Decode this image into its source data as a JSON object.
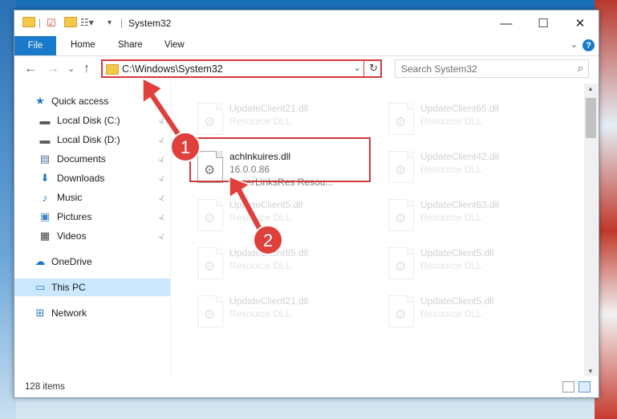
{
  "window": {
    "title": "System32",
    "minimize_glyph": "—",
    "maximize_glyph": "☐",
    "close_glyph": "✕"
  },
  "ribbon": {
    "tabs": [
      "File",
      "Home",
      "Share",
      "View"
    ],
    "help_glyph": "?",
    "collapse_glyph": "⌄"
  },
  "nav": {
    "back": "←",
    "forward": "→",
    "recent": "⌄",
    "up": "↑",
    "address": "C:\\Windows\\System32",
    "address_dropdown": "⌄",
    "refresh": "↻",
    "search_placeholder": "Search System32",
    "search_icon_glyph": "⌕"
  },
  "sidebar": {
    "items": [
      {
        "label": "Quick access",
        "icon": "star-icon",
        "glyph": "★",
        "color": "#1979ca",
        "indent": false,
        "pinned": false
      },
      {
        "label": "Local Disk (C:)",
        "icon": "drive-icon",
        "glyph": "▬",
        "color": "#5a5a5a",
        "indent": true,
        "pinned": true
      },
      {
        "label": "Local Disk (D:)",
        "icon": "drive-icon",
        "glyph": "▬",
        "color": "#5a5a5a",
        "indent": true,
        "pinned": true
      },
      {
        "label": "Documents",
        "icon": "documents-icon",
        "glyph": "▤",
        "color": "#4a6f9c",
        "indent": true,
        "pinned": true
      },
      {
        "label": "Downloads",
        "icon": "download-icon",
        "glyph": "⬇",
        "color": "#1979ca",
        "indent": true,
        "pinned": true
      },
      {
        "label": "Music",
        "icon": "music-icon",
        "glyph": "♪",
        "color": "#1979ca",
        "indent": true,
        "pinned": true
      },
      {
        "label": "Pictures",
        "icon": "pictures-icon",
        "glyph": "▣",
        "color": "#3d86c9",
        "indent": true,
        "pinned": true
      },
      {
        "label": "Videos",
        "icon": "videos-icon",
        "glyph": "▦",
        "color": "#444444",
        "indent": true,
        "pinned": true
      },
      {
        "label": "OneDrive",
        "icon": "cloud-icon",
        "glyph": "☁",
        "color": "#1979ca",
        "indent": false,
        "pinned": false
      },
      {
        "label": "This PC",
        "icon": "computer-icon",
        "glyph": "▭",
        "color": "#2a7fc6",
        "indent": false,
        "pinned": false,
        "active": true
      },
      {
        "label": "Network",
        "icon": "network-icon",
        "glyph": "⊞",
        "color": "#2a7fc6",
        "indent": false,
        "pinned": false
      }
    ],
    "pin_glyph": "📌"
  },
  "files": [
    {
      "name": "UpdateClient21.dll",
      "line2": "Resource DLL",
      "line3": "",
      "faded": true
    },
    {
      "name": "UpdateClient65.dll",
      "line2": "Resource DLL",
      "line3": "",
      "faded": true
    },
    {
      "name": "achlnkuires.dll",
      "line2": "16.0.0.86",
      "line3": "HyperLinksRes Resou...",
      "faded": false
    },
    {
      "name": "UpdateClient42.dll",
      "line2": "Resource DLL",
      "line3": "",
      "faded": true
    },
    {
      "name": "UpdateClient5.dll",
      "line2": "Resource DLL",
      "line3": "",
      "faded": true
    },
    {
      "name": "UpdateClient63.dll",
      "line2": "Resource DLL",
      "line3": "",
      "faded": true
    },
    {
      "name": "UpdateClient65.dll",
      "line2": "Resource DLL",
      "line3": "",
      "faded": true
    },
    {
      "name": "UpdateClient5.dll",
      "line2": "Resource DLL",
      "line3": "",
      "faded": true
    },
    {
      "name": "UpdateClient21.dll",
      "line2": "Resource DLL",
      "line3": "",
      "faded": true
    },
    {
      "name": "UpdateClient5.dll",
      "line2": "Resource DLL",
      "line3": "",
      "faded": true
    }
  ],
  "status": {
    "item_count": "128 items"
  },
  "annotations": {
    "step1": "1",
    "step2": "2",
    "color": "#e0403c"
  }
}
